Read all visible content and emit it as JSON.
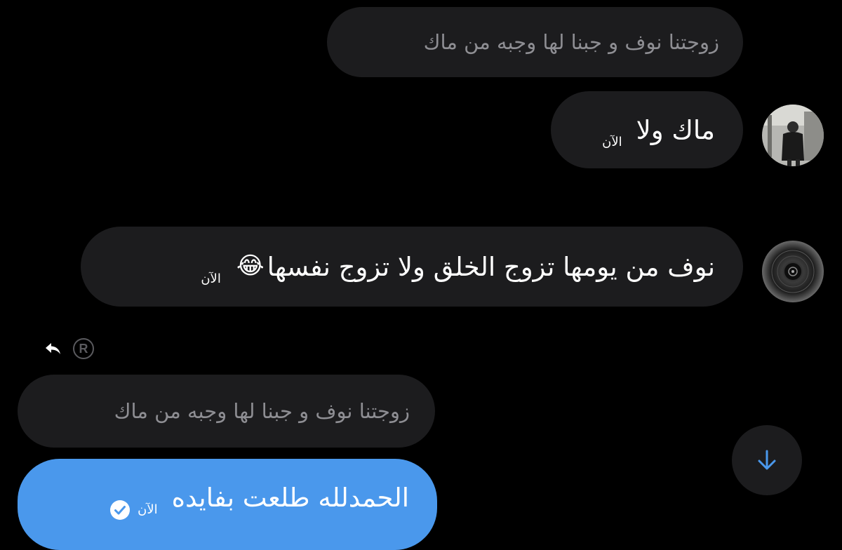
{
  "messages": [
    {
      "id": "q1",
      "text": "زوجتنا نوف و جبنا لها وجبه من ماك"
    },
    {
      "id": "m2",
      "text": "ماك ولا",
      "time": "الآن"
    },
    {
      "id": "m3",
      "text": "نوف من يومها تزوج الخلق ولا تزوج نفسها",
      "emoji": "😂",
      "time": "الآن"
    },
    {
      "id": "q2",
      "text": "زوجتنا نوف و جبنا لها وجبه من ماك"
    },
    {
      "id": "m4",
      "text": "الحمدلله طلعت بفايده",
      "time": "الآن"
    }
  ],
  "reply_indicator": {
    "symbol": "R"
  },
  "colors": {
    "background": "#000000",
    "incoming_bubble": "#1c1c1e",
    "outgoing_bubble": "#4a98ec",
    "quoted_text": "#8e8e93",
    "scroll_arrow": "#4a98ec"
  },
  "icons": {
    "reply": "reply-arrow-icon",
    "registered": "registered-icon",
    "read": "check-circle-icon",
    "scroll": "arrow-down-icon"
  }
}
